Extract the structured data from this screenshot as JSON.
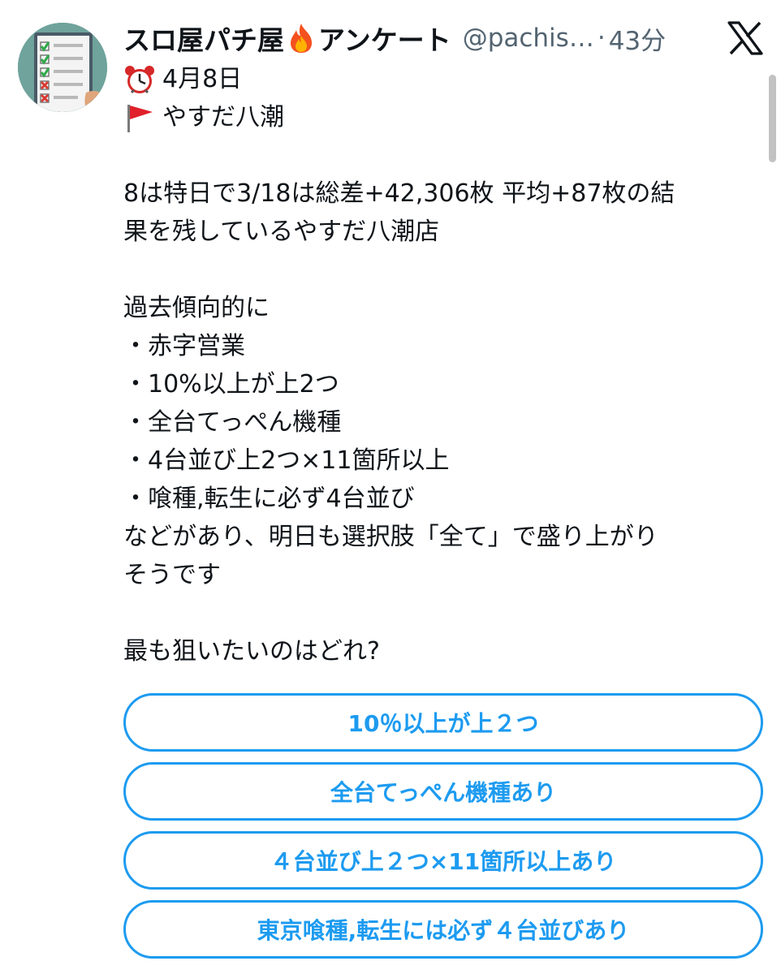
{
  "author": {
    "display_name": "スロ屋パチ屋",
    "display_name_suffix": "アンケート",
    "handle": "@pachis…",
    "separator": "·",
    "time": "43分",
    "avatar_icon": "checklist-avatar",
    "name_emoji": "fire-icon"
  },
  "platform": {
    "logo": "x-logo-icon"
  },
  "tweet": {
    "date_emoji": "alarm-clock-icon",
    "date": "4月8日",
    "store_emoji": "red-flag-icon",
    "store": "やすだ八潮",
    "summary_line1": "8は特日で3/18は総差+42,306枚 平均+87枚の結",
    "summary_line2": "果を残しているやすだ八潮店",
    "trend_heading": "過去傾向的に",
    "bullets": [
      "・赤字営業",
      "・10%以上が上2つ",
      "・全台てっぺん機種",
      "・4台並び上2つ×11箇所以上",
      "・喰種,転生に必ず4台並び"
    ],
    "closing_line1": "などがあり、明日も選択肢「全て」で盛り上がり",
    "closing_line2": "そうです",
    "question": "最も狙いたいのはどれ?"
  },
  "poll": {
    "accent_color": "#1d9bf0",
    "options": [
      "10％以上が上２つ",
      "全台てっぺん機種あり",
      "４台並び上２つ×11箇所以上あり",
      "東京喰種,転生には必ず４台並びあり"
    ]
  }
}
